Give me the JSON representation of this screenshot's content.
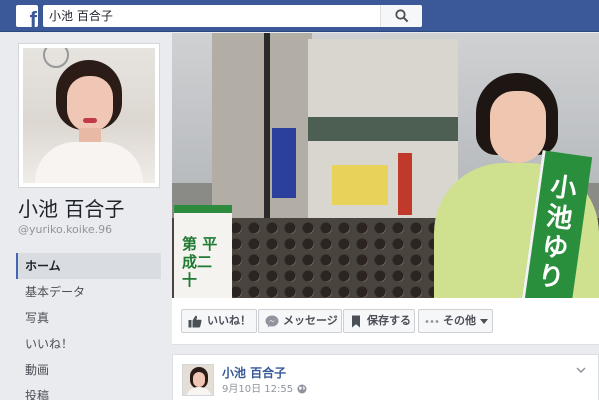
{
  "search": {
    "value": "小池 百合子"
  },
  "page": {
    "name": "小池 百合子",
    "handle": "@yuriko.koike.96"
  },
  "nav": {
    "items": [
      {
        "label": "ホーム",
        "active": true
      },
      {
        "label": "基本データ"
      },
      {
        "label": "写真"
      },
      {
        "label": "いいね！"
      },
      {
        "label": "動画"
      },
      {
        "label": "投稿"
      }
    ]
  },
  "cover": {
    "banner_text": "第 平成二十",
    "sash_text": "小池ゆり"
  },
  "actions": {
    "like": "いいね！",
    "message": "メッセージ",
    "save": "保存する",
    "more": "その他"
  },
  "post": {
    "author": "小池 百合子",
    "date": "9月10日 12:55 ·"
  },
  "colors": {
    "topbar": "#3b5998",
    "link": "#365899",
    "accent": "#4267b2"
  }
}
